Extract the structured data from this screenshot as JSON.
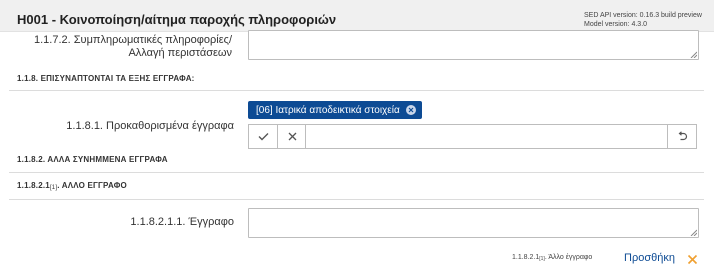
{
  "header": {
    "title": "H001 - Κοινοποίηση/αίτημα παροχής πληροφοριών",
    "api_version": "SED API version: 0.16.3 build preview",
    "model_version": "Model version: 4.3.0"
  },
  "field_1_1_7_2": {
    "label_line1": "1.1.7.2. Συμπληρωματικές πληροφορίες/",
    "label_line2": "Αλλαγή περιστάσεων",
    "value": ""
  },
  "section_1_1_8": {
    "title": "1.1.8. ΕΠΙΣΥΝΑΠΤΟΝΤΑΙ ΤΑ ΕΞΗΣ ΕΓΓΡΑΦΑ:"
  },
  "field_1_1_8_1": {
    "label": "1.1.8.1. Προκαθορισμένα έγγραφα",
    "chip_label": "[06] Ιατρικά αποδεικτικά στοιχεία",
    "input_value": ""
  },
  "section_1_1_8_2": {
    "title": "1.1.8.2. ΑΛΛΑ ΣΥΝΗΜΜΕΝΑ ΕΓΓΡΑΦΑ"
  },
  "section_1_1_8_2_1": {
    "title_prefix": "1.1.8.2.1",
    "title_index": "[1]",
    "title_suffix": ". ΑΛΛΟ ΕΓΓΡΑΦΟ"
  },
  "field_1_1_8_2_1_1": {
    "label": "1.1.8.2.1.1. Έγγραφο",
    "value": ""
  },
  "footer": {
    "ref_prefix": "1.1.8.2.1",
    "ref_index": "[1]",
    "ref_suffix": ". Άλλο έγγραφο",
    "add_label": "Προσθήκη"
  },
  "colors": {
    "accent": "#0d4b94",
    "close_orange": "#f0a030"
  },
  "icons": {
    "chip_remove": "close-circle-icon",
    "confirm": "check-icon",
    "clear": "close-icon",
    "reset": "undo-icon",
    "footer_remove": "close-icon"
  }
}
